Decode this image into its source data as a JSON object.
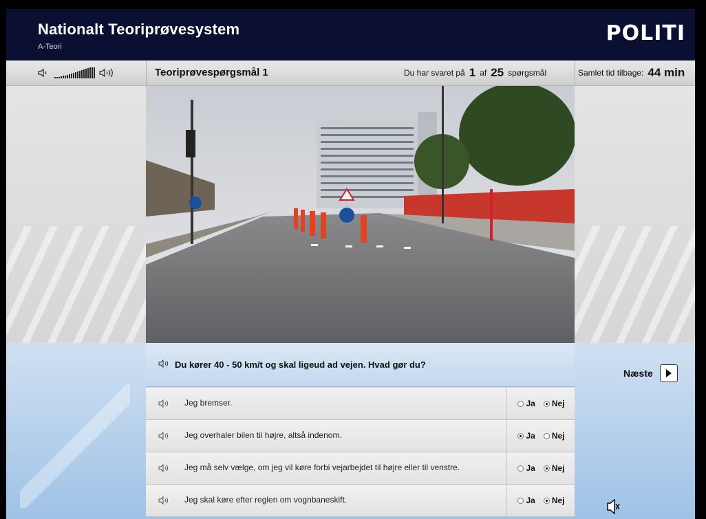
{
  "header": {
    "title": "Nationalt Teoriprøvesystem",
    "subtitle": "A-Teori",
    "brand": "POLITI"
  },
  "statusbar": {
    "question_title": "Teoriprøvespørgsmål 1",
    "answered_prefix": "Du har svaret på",
    "answered_count": "1",
    "answered_of": "af",
    "total_questions": "25",
    "answered_suffix": "spørgsmål",
    "time_label": "Samlet tid tilbage:",
    "time_value": "44 min"
  },
  "question": {
    "text": "Du kører 40 - 50 km/t og skal ligeud ad vejen. Hvad gør du?"
  },
  "answers": [
    {
      "text": "Jeg bremser.",
      "selected": "Nej"
    },
    {
      "text": "Jeg overhaler bilen til højre, altså indenom.",
      "selected": "Ja"
    },
    {
      "text": "Jeg må selv vælge, om jeg vil køre forbi vejarbejdet til højre eller til venstre.",
      "selected": "Nej"
    },
    {
      "text": "Jeg skal køre efter reglen om vognbaneskift.",
      "selected": "Nej"
    }
  ],
  "labels": {
    "yes": "Ja",
    "no": "Nej",
    "next": "Næste"
  },
  "icons": {
    "speaker": "speaker-icon",
    "next": "play-arrow-icon",
    "mute": "mute-icon"
  }
}
